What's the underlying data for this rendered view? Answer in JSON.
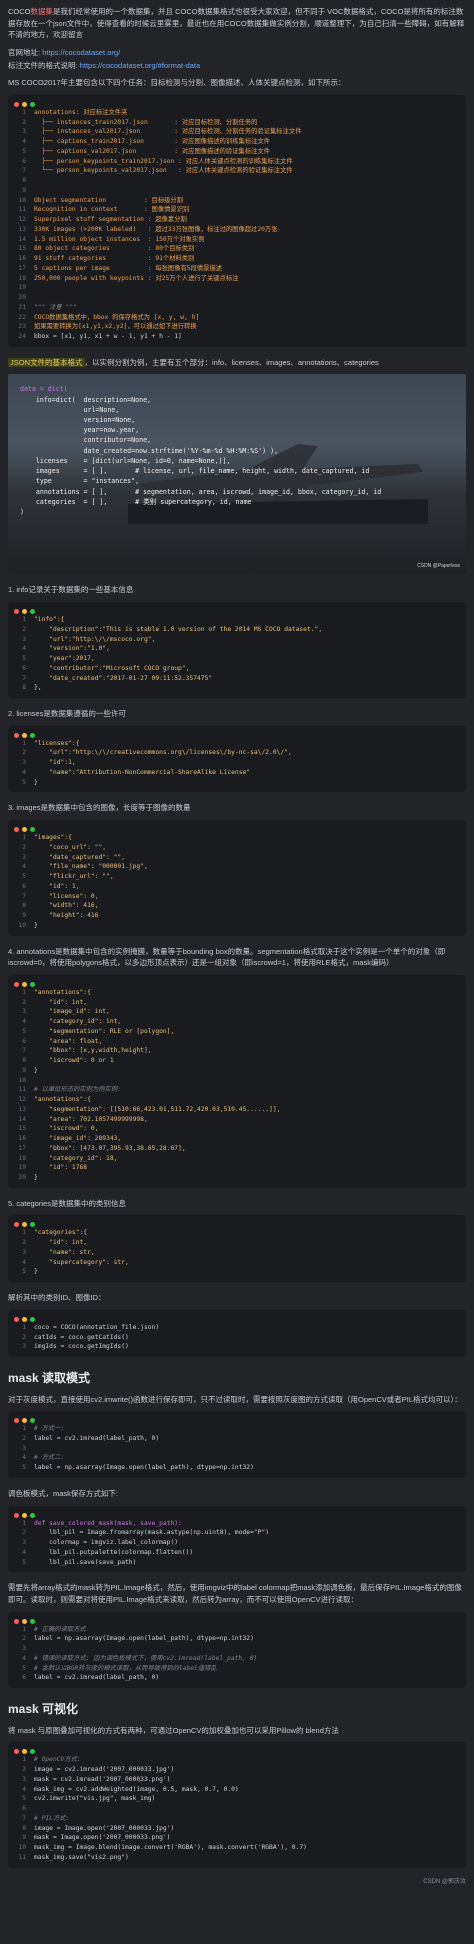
{
  "intro": {
    "p1_pre": "COCO",
    "p1_link": "数据集",
    "p1_post": "是我们经常使用的一个数据集，并且 COCO数据集格式也很受大家欢迎，但不同于 VOC数据格式，COCO是将所有的标注数据存放在一个json文件中，使得查看的时候云里雾里，最近也在用COCO数据集做实例分割，顺道整理下，为自己扫清一些障碍，如有解释不清的地方，欢迎留言",
    "site_label": "官网地址:",
    "site_url": "https://cocodataset.org/",
    "format_label": "标注文件的格式说明:",
    "format_url": "https://cocodataset.org/#format-data",
    "tasks": "MS COCO2017年主要包含以下四个任务：目标检测与分割、图像描述、人体关键点检测，如下所示："
  },
  "code1": [
    "annotations: 对应标注文件夹",
    "  ├── instances_train2017.json       : 对应目标检测、分割任务的",
    "  ├── instances_val2017.json         : 对应目标检测、分割任务的验证集标注文件",
    "  ├── captions_train2017.json        : 对应图像描述的训练集标注文件",
    "  ├── captions_val2017.json          : 对应图像描述的验证集标注文件",
    "  ├── person_keypoints_train2017.json : 对应人体关键点检测的训练集标注文件",
    "  └── person_keypoints_val2017.json   : 对应人体关键点检测的验证集标注文件",
    "",
    "",
    "Object segmentation          : 目标级分割",
    "Recognition in context       : 图像情景识别",
    "Superpixel stuff segmentation : 超像素分割",
    "330K images (>200K labeled)   : 超过33万张图像，标注过的图像超过20万张",
    "1.5 million object instances  : 150万个对象实例",
    "80 object categories          : 80个目标类别",
    "91 stuff categories           : 91个材料类别",
    "5 captions per image          : 每张图像有5段情景描述",
    "250,000 people with keypoints : 对25万个人进行了关键点标注",
    "",
    "",
    "\"\"\" 注意 \"\"\"",
    "COCO数据集格式中，bbox 的保存格式为 [x, y, w, h]",
    "如果需要转换为[x1,y1,x2,y2]，可以通过如下进行转换",
    "bbox = [x1, y1, x1 + w - 1, y1 + h - 1]"
  ],
  "json_intro_hl": "JSON文件的基本格式",
  "json_intro_rest": "，以实例分割为例，主要有五个部分：info、licenses、images、annotations、categories",
  "img_code": [
    "data = dict(",
    "    info=dict(  description=None,",
    "                url=None,",
    "                version=None,",
    "                year=now.year,",
    "                contributor=None,",
    "                date_created=now.strftime('%Y-%m-%d %H:%M:%S') ),",
    "    licenses    = [dict(url=None, id=0, name=None,)],",
    "    images      = [ ],       # license, url, file_name, height, width, date_captured, id",
    "    type        = \"instances\",",
    "    annotations = [ ],       # segmentation, area, iscrowd, image_id, bbox, category_id, id",
    "    categories  = [ ],       # 类别 supercategory, id, name",
    ")"
  ],
  "img_wm": "CSDN @Paperless",
  "s1": "1. info记录关于数据集的一些基本信息",
  "code_info": [
    "\"info\":{",
    "    \"description\":\"This is stable 1.0 version of the 2014 MS COCO dataset.\",",
    "    \"url\":\"http:\\/\\/mscoco.org\",",
    "    \"version\":\"1.0\",",
    "    \"year\":2017,",
    "    \"contributor\":\"Microsoft COCO group\",",
    "    \"date_created\":\"2017-01-27 09:11:52.357475\"",
    "},"
  ],
  "s2": "2. licenses是数据集遵循的一些许可",
  "code_lic": [
    "\"licenses\":{",
    "    \"url\":\"http:\\/\\/creativecommons.org\\/licenses\\/by-nc-sa\\/2.0\\/\",",
    "    \"id\":1,",
    "    \"name\":\"Attribution-NonCommercial-ShareAlike License\"",
    "}"
  ],
  "s3": "3. images是数据集中包含的图像，长度等于图像的数量",
  "code_img": [
    "\"images\":{",
    "    \"coco_url\": \"\",",
    "    \"date_captured\": \"\",",
    "    \"file_name\": \"000001.jpg\",",
    "    \"flickr_url\": \"\",",
    "    \"id\": 1,",
    "    \"license\": 0,",
    "    \"width\": 416,",
    "    \"height\": 416",
    "}"
  ],
  "s4": "4. annotations是数据集中包含的实例掩膜，数量等于bounding box的数量。segmentation格式取决于这个实例是一个单个的对象（即iscrowd=0，将使用polygons格式，以多边形顶点表示）还是一组对象（即iscrowd=1，将使用RLE格式，mask编码）",
  "code_ann": [
    "\"annotations\":{",
    "    \"id\": int,",
    "    \"image_id\": int,",
    "    \"category_id\": int,",
    "    \"segmentation\": RLE or [polygon],",
    "    \"area\": float,",
    "    \"bbox\": [x,y,width,height],",
    "    \"iscrowd\": 0 or 1",
    "}",
    "",
    "# 以单位形态的实例为例实例:",
    "\"annotations\":{",
    "    \"segmentation\": [[510.66,423.01,511.72,420.03,510.45......]],",
    "    \"area\": 702.1057499999998,",
    "    \"iscrowd\": 0,",
    "    \"image_id\": 289343,",
    "    \"bbox\": [473.07,395.93,38.65,28.67],",
    "    \"category_id\": 18,",
    "    \"id\": 1768",
    "}"
  ],
  "s5": "5. categories是数据集中的类别信息",
  "code_cat": [
    "\"categories\":{",
    "    \"id\": int,",
    "    \"name\": str,",
    "    \"supercategory\": str,",
    "}"
  ],
  "s6": "解析其中的类别ID、图像ID：",
  "code_parse": [
    "coco = COCO(annotation_file.json)",
    "catIds = coco.getCatIds()",
    "imgIds = coco.getImgIds()"
  ],
  "h_mask_read": "mask 读取模式",
  "p_mask_read": "对于灰度模式，直接使用cv2.imwrite()函数进行保存即可，只不过读取时，需要按照灰度图的方式读取（用OpenCV或者PIL格式均可以）：",
  "code_read": [
    "# 方式一:",
    "label = cv2.imread(label_path, 0)",
    "",
    "# 方式二:",
    "label = np.asarray(Image.open(label_path), dtype=np.int32)"
  ],
  "p_palette": "调色板模式，mask保存方式如下:",
  "code_palette": [
    "def save_colored_mask(mask, save_path):",
    "    lbl_pil = Image.fromarray(mask.astype(np.uint8), mode=\"P\")",
    "    colormap = imgviz.label_colormap()",
    "    lbl_pil.putpalette(colormap.flatten())",
    "    lbl_pil.save(save_path)"
  ],
  "p_palette2": "需要先将array格式的mask转为PIL.Image格式，然后，使用imgviz中的label colormap把mask添加调色板，最后保存PIL.Image格式的图像即可。读取时，则需要对将使用PIL.Image格式来读取，然后转为array，而不可以使用OpenCV进行读取：",
  "code_read2": [
    "# 正确的读取方式",
    "label = np.asarray(Image.open(label_path), dtype=np.int32)",
    "",
    "# 错误的读取方式: 因为调色板模式下，使用cv2.imread(label_path, 0)",
    "# 会默认以BGR转灰度的模式读取，从而导致得到的label值错乱",
    "label = cv2.imread(label_path, 0)"
  ],
  "h_mask_vis": "mask 可视化",
  "p_vis": "将 mask 与原图叠加可视化的方式有两种，可通过OpenCV的加权叠加也可以采用Pillow的 blend方法",
  "code_vis": [
    "# OpenCV方式:",
    "image = cv2.imread('2007_000033.jpg')",
    "mask = cv2.imread('2007_000033.png')",
    "mask_img = cv2.addWeighted(image, 0.5, mask, 0.7, 0.0)",
    "cv2.imwrite(\"vis.jpg\", mask_img)",
    "",
    "# PIL方式:",
    "image = Image.open('2007_000033.jpg')",
    "mask = Image.open('2007_000033.png')",
    "mask_img = Image.blend(image.convert('RGBA'), mask.convert('RGBA'), 0.7)",
    "mask_img.save(\"vis2.png\")"
  ],
  "footer": "CSDN @郭庆汝"
}
